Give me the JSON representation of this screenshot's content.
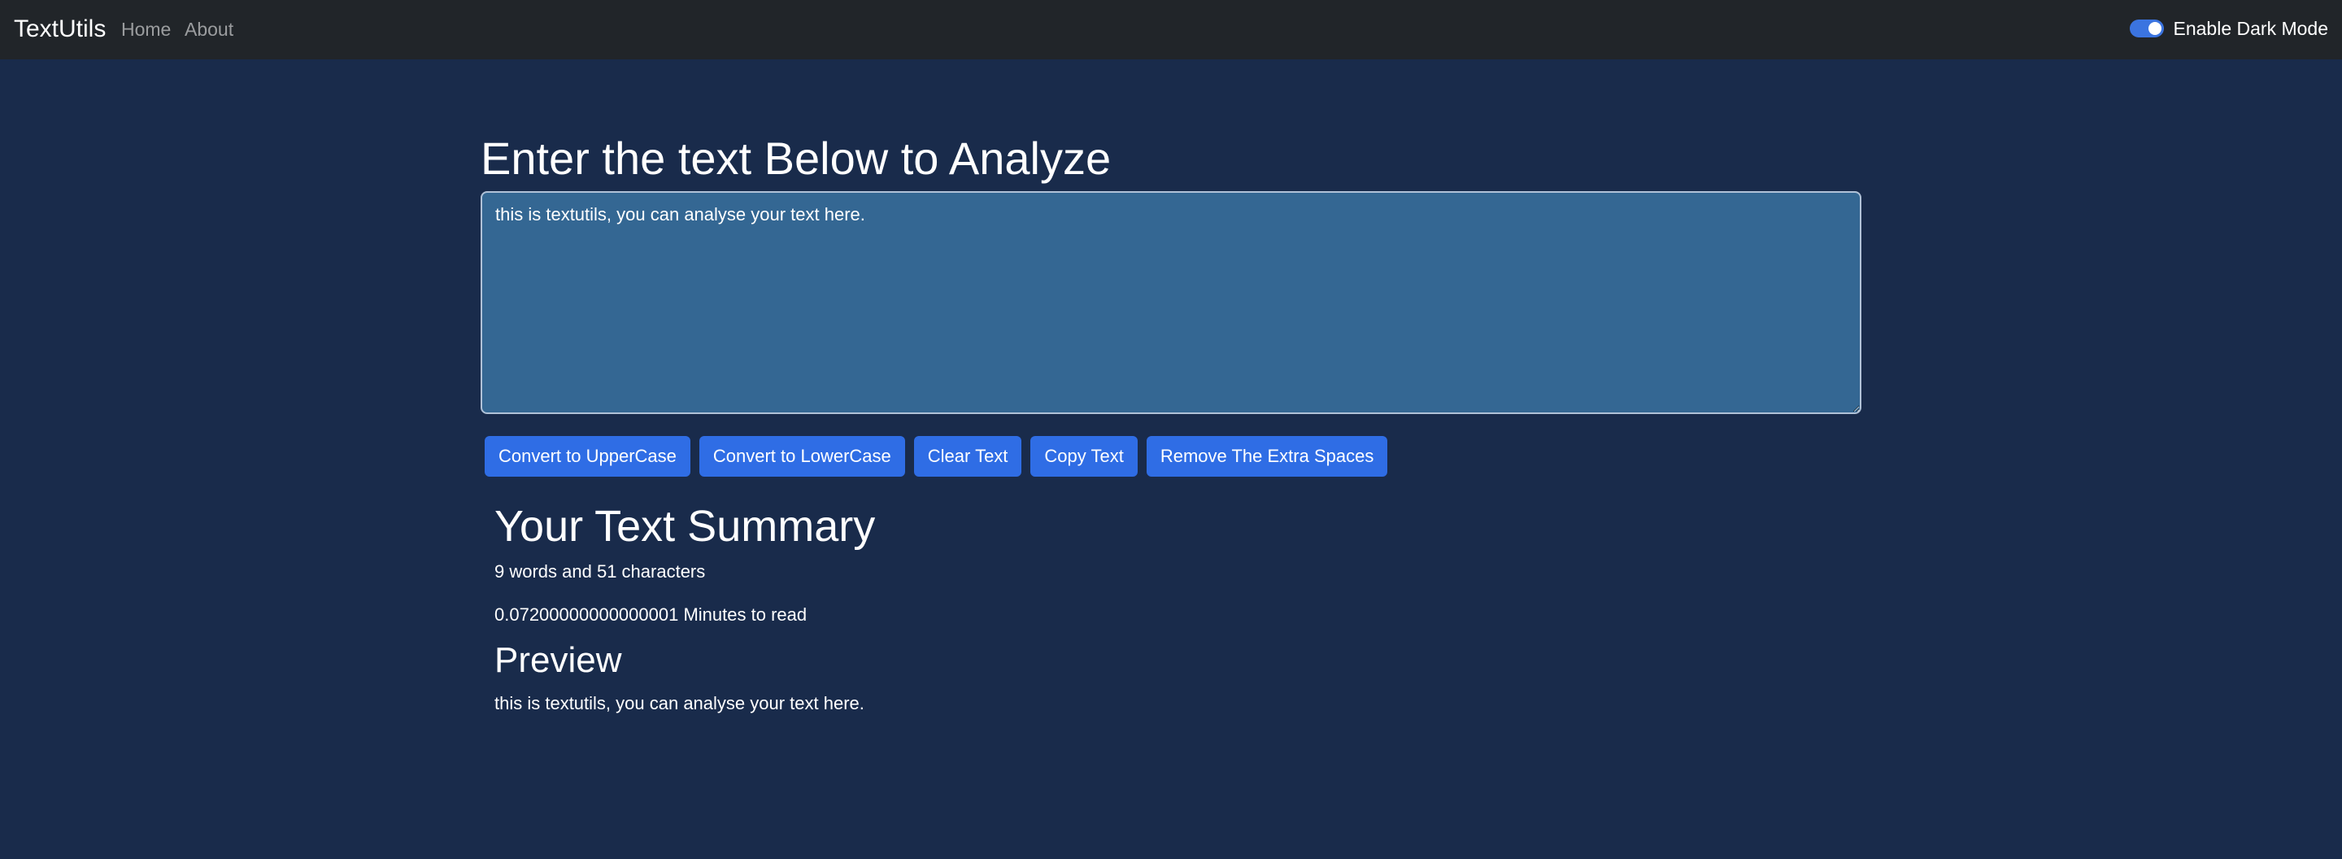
{
  "navbar": {
    "brand": "TextUtils",
    "links": [
      "Home",
      "About"
    ],
    "dark_mode_label": "Enable Dark Mode",
    "dark_mode_enabled": true
  },
  "main": {
    "heading": "Enter the text Below to Analyze",
    "textarea_value": "this is textutils, you can analyse your text here.",
    "buttons": [
      "Convert to UpperCase",
      "Convert to LowerCase",
      "Clear Text",
      "Copy Text",
      "Remove The Extra Spaces"
    ]
  },
  "summary": {
    "title": "Your Text Summary",
    "count_line": "9 words and 51 characters",
    "read_time_line": "0.07200000000000001 Minutes to read",
    "preview_title": "Preview",
    "preview_text": "this is textutils, you can analyse your text here."
  },
  "colors": {
    "navbar_bg": "#212529",
    "page_bg": "#192b4b",
    "textarea_bg": "#346793",
    "button_bg": "#2f6de5"
  }
}
